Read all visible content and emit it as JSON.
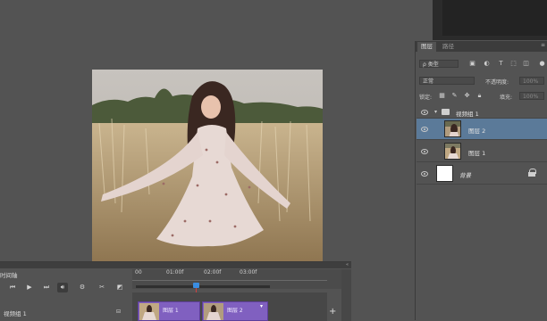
{
  "layers_panel": {
    "tabs": [
      "图层",
      "路径"
    ],
    "filter_label": "ρ 类型",
    "blend_mode": "正常",
    "opacity_label": "不透明度:",
    "opacity_value": "100%",
    "lock_label": "锁定:",
    "fill_label": "填充:",
    "fill_value": "100%",
    "layers": [
      {
        "name": "视频组 1",
        "type": "group"
      },
      {
        "name": "图层 2",
        "type": "video",
        "selected": true
      },
      {
        "name": "图层 1",
        "type": "video",
        "selected": false
      },
      {
        "name": "背景",
        "type": "background",
        "locked": true
      }
    ]
  },
  "timeline": {
    "title": "时间轴",
    "ruler_labels": [
      "00",
      "01:00f",
      "02:00f",
      "03:00f"
    ],
    "track_name": "视频组 1",
    "clips": [
      "图层 1",
      "图层 2"
    ],
    "controls": [
      "go-to-first-frame",
      "play",
      "go-to-next-frame",
      "audio",
      "settings",
      "split",
      "transition"
    ],
    "add_button": "+"
  },
  "icons": [
    "eye-icon",
    "folder-icon",
    "lock-icon",
    "scissors-icon",
    "speaker-icon",
    "gear-icon",
    "play-icon"
  ],
  "colors": {
    "clip": "#8060c0",
    "playhead": "#3a8de0",
    "selected_layer": "#5b7a99",
    "panel": "#535353"
  }
}
